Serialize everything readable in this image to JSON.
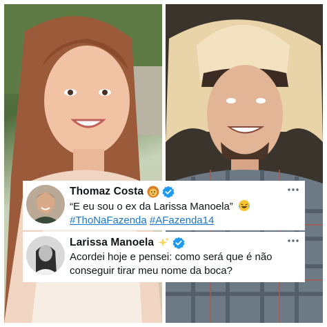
{
  "photos": {
    "left_alt": "woman smiling outdoors",
    "right_alt": "man in cowboy hat smiling"
  },
  "tweets": [
    {
      "display_name": "Thomaz Costa",
      "name_emoji": "lion-emoji",
      "verified": true,
      "text": "“E eu sou o ex da Larissa Manoela”",
      "text_emoji": "laughing-tears-emoji",
      "hashtags": [
        "#ThoNaFazenda",
        "#AFazenda14"
      ]
    },
    {
      "display_name": "Larissa Manoela",
      "name_emoji": "sparkles-emoji",
      "verified": true,
      "text": "Acordei hoje e pensei: como será que é não conseguir tirar meu nome da boca?"
    }
  ],
  "colors": {
    "verified": "#1d9bf0",
    "hashtag": "#1d77c9",
    "text": "#0f1419"
  }
}
